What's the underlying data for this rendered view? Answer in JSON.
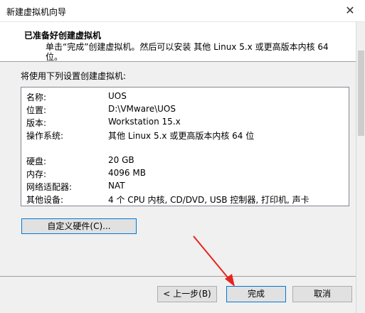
{
  "window": {
    "title": "新建虚拟机向导",
    "close_glyph": "✕"
  },
  "header": {
    "title": "已准备好创建虚拟机",
    "description": "单击“完成”创建虚拟机。然后可以安装 其他 Linux 5.x 或更高版本内核 64 位。"
  },
  "summary": {
    "label": "将使用下列设置创建虚拟机:",
    "rows": [
      {
        "key": "名称:",
        "value": "UOS"
      },
      {
        "key": "位置:",
        "value": "D:\\VMware\\UOS"
      },
      {
        "key": "版本:",
        "value": "Workstation 15.x"
      },
      {
        "key": "操作系统:",
        "value": "其他 Linux 5.x 或更高版本内核 64 位"
      },
      {
        "key": "硬盘:",
        "value": "20 GB"
      },
      {
        "key": "内存:",
        "value": "4096 MB"
      },
      {
        "key": "网络适配器:",
        "value": "NAT"
      },
      {
        "key": "其他设备:",
        "value": "4 个 CPU 内核, CD/DVD, USB 控制器, 打印机, 声卡"
      }
    ]
  },
  "buttons": {
    "customize": "自定义硬件(C)...",
    "back": "< 上一步(B)",
    "finish": "完成",
    "cancel": "取消"
  },
  "colors": {
    "annotation_arrow": "#e8231e",
    "focus_border": "#0078d7"
  }
}
